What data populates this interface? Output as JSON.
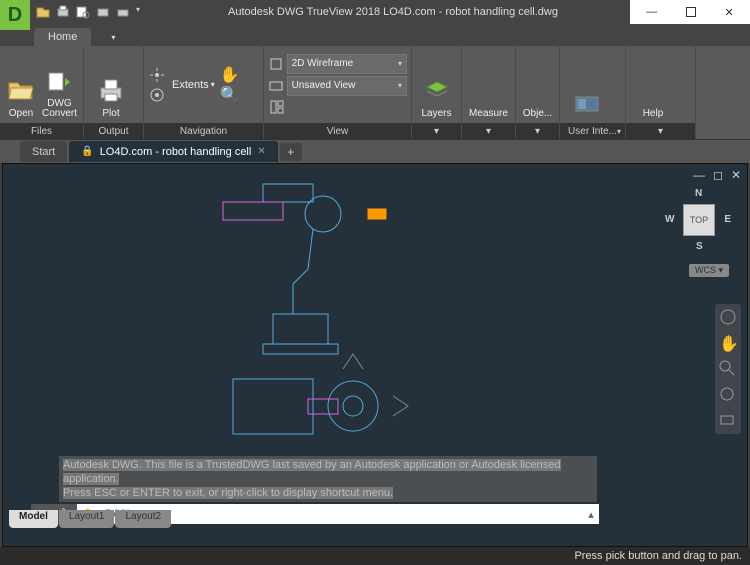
{
  "app": {
    "title": "Autodesk DWG TrueView 2018    LO4D.com - robot handling cell.dwg",
    "logo_letter": "D"
  },
  "ribbon": {
    "tab": "Home",
    "panels": {
      "files": {
        "title": "Files",
        "open": "Open",
        "convert": "DWG Convert",
        "plot": "Plot"
      },
      "output": {
        "title": "Output"
      },
      "navigation": {
        "title": "Navigation",
        "extents": "Extents"
      },
      "view": {
        "title": "View",
        "visual_style": "2D Wireframe",
        "named_view": "Unsaved View"
      },
      "layers": {
        "title": "Layers",
        "label": "Layers"
      },
      "measure": {
        "title": "",
        "label": "Measure"
      },
      "object": {
        "title": "",
        "label": "Obje..."
      },
      "ui": {
        "title": "User Inte...",
        "label": ""
      },
      "help": {
        "title": "",
        "label": "Help"
      }
    }
  },
  "tabs": {
    "start": "Start",
    "file": "LO4D.com - robot handling cell"
  },
  "viewcube": {
    "top": "TOP",
    "n": "N",
    "s": "S",
    "e": "E",
    "w": "W",
    "wcs": "WCS"
  },
  "command": {
    "history_line1": "Autodesk DWG.  This file is a TrustedDWG last saved by an Autodesk application or Autodesk licensed application.",
    "history_line2": "Press ESC or ENTER to exit, or right-click to display shortcut menu.",
    "current": "PAN"
  },
  "layout": {
    "model": "Model",
    "l1": "Layout1",
    "l2": "Layout2"
  },
  "status": {
    "message": "Press pick button and drag to pan."
  }
}
